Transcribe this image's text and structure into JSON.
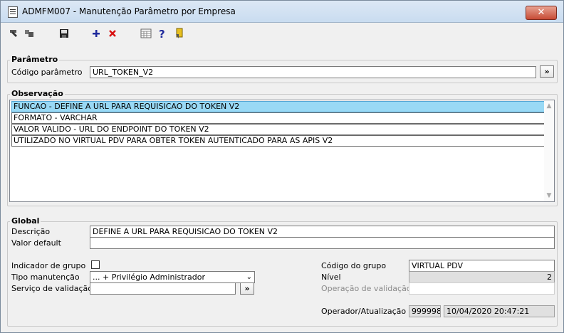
{
  "window": {
    "title": "ADMFM007 - Manutenção Parâmetro por Empresa",
    "close_label": "✕"
  },
  "toolbar": {
    "icons": [
      "first-icon",
      "previous-icon",
      "save-icon",
      "add-icon",
      "delete-icon",
      "calculator-icon",
      "help-icon",
      "exit-icon"
    ]
  },
  "parametro": {
    "legend": "Parâmetro",
    "codigo_label": "Código parâmetro",
    "codigo_value": "URL_TOKEN_V2",
    "lookup_label": "»"
  },
  "observacao": {
    "legend": "Observação",
    "lines": [
      "FUNCAO - DEFINE A URL PARA REQUISICAO DO TOKEN V2",
      "FORMATO - VARCHAR",
      "VALOR VALIDO - URL DO ENDPOINT DO TOKEN V2",
      "UTILIZADO NO VIRTUAL PDV PARA OBTER TOKEN AUTENTICADO PARA AS APIS V2"
    ]
  },
  "global": {
    "legend": "Global",
    "descricao_label": "Descrição",
    "descricao_value": "DEFINE A URL PARA REQUISICAO DO TOKEN V2",
    "valor_default_label": "Valor default",
    "valor_default_value": "",
    "indicador_grupo_label": "Indicador de grupo",
    "indicador_grupo_checked": false,
    "tipo_manutencao_label": "Tipo manutenção",
    "tipo_manutencao_value": "... + Privilégio Administrador",
    "servico_validacao_label": "Serviço de validação",
    "servico_validacao_value": "",
    "servico_lookup_label": "»",
    "codigo_grupo_label": "Código do grupo",
    "codigo_grupo_value": "VIRTUAL PDV",
    "nivel_label": "Nível",
    "nivel_value": "2",
    "operacao_validacao_label": "Operação de validação",
    "operacao_validacao_value": "",
    "operador_label": "Operador/Atualização",
    "operador_value": "999998",
    "atualizacao_value": "10/04/2020 20:47:21"
  }
}
